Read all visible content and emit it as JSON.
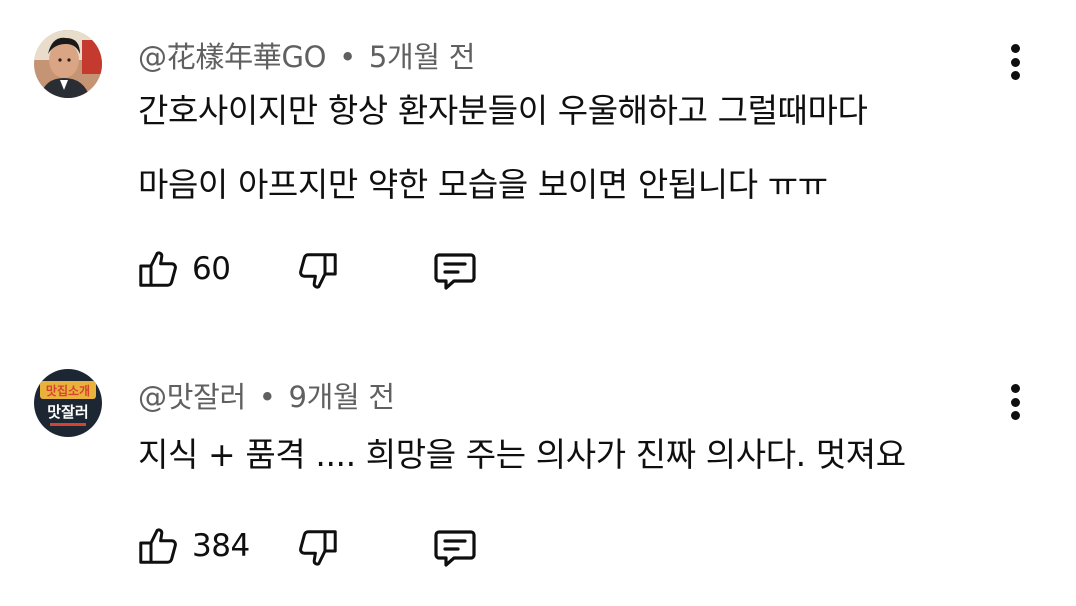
{
  "comments": [
    {
      "author": "@花樣年華GO",
      "separator": "•",
      "time": "5개월 전",
      "lines": [
        "간호사이지만 항상 환자분들이 우울해하고 그럴때마다",
        "마음이 아프지만 약한 모습을 보이면 안됩니다 ㅠㅠ"
      ],
      "like_count": "60",
      "avatar_icon": "avatar-photo-man",
      "avatar_colors": {
        "bg": "#b98a6a",
        "hair": "#1c1a18",
        "face": "#d9a585",
        "suit": "#2a2d33",
        "accent": "#c43a2e"
      }
    },
    {
      "author": "@맛잘러",
      "separator": "•",
      "time": "9개월 전",
      "lines": [
        "지식 + 품격 .... 희망을 주는 의사가 진짜 의사다. 멋져요"
      ],
      "like_count": "384",
      "avatar_icon": "avatar-channel-logo",
      "avatar_logo_text": [
        "맛집소개",
        "맛잘러"
      ],
      "avatar_colors": {
        "bg": "#1d2733",
        "top": "#e9b23c",
        "mid": "#ffffff",
        "accent": "#d8432f"
      }
    }
  ],
  "icons": {
    "like": "thumbs-up-icon",
    "dislike": "thumbs-down-icon",
    "reply": "reply-comment-icon",
    "menu": "more-vertical-icon"
  },
  "colors": {
    "text": "#0f0f0f",
    "meta": "#606060",
    "background": "#ffffff"
  }
}
